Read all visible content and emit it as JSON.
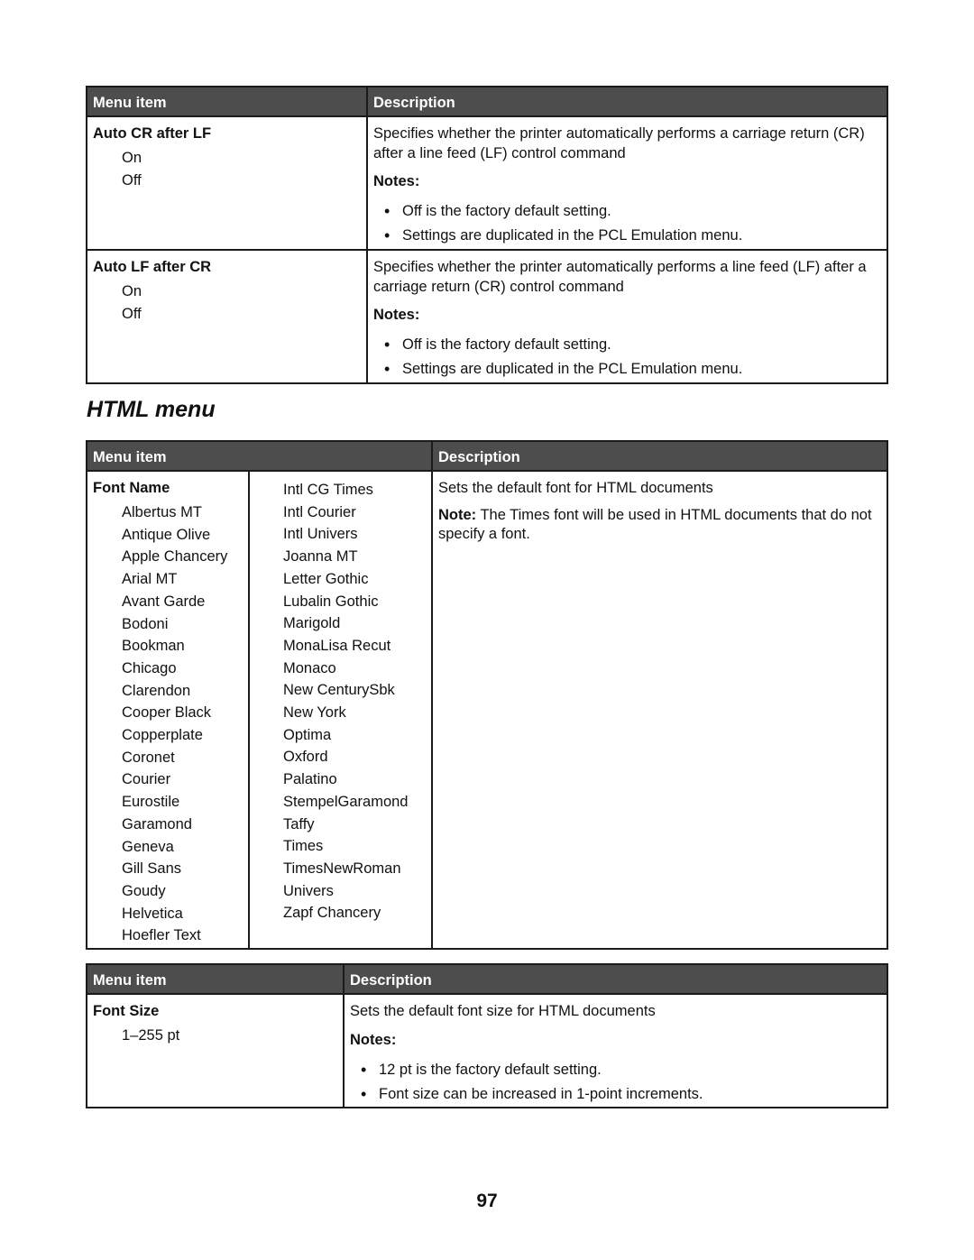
{
  "table1": {
    "header": {
      "menu_item": "Menu item",
      "description": "Description"
    },
    "rows": [
      {
        "title": "Auto CR after LF",
        "options": [
          "On",
          "Off"
        ],
        "description": "Specifies whether the printer automatically performs a carriage return (CR) after a line feed (LF) control command",
        "notes_label": "Notes:",
        "notes": [
          "Off is the factory default setting.",
          "Settings are duplicated in the PCL Emulation menu."
        ]
      },
      {
        "title": "Auto LF after CR",
        "options": [
          "On",
          "Off"
        ],
        "description": "Specifies whether the printer automatically performs a line feed (LF) after a carriage return (CR) control command",
        "notes_label": "Notes:",
        "notes": [
          "Off is the factory default setting.",
          "Settings are duplicated in the PCL Emulation menu."
        ]
      }
    ]
  },
  "section_title": "HTML menu",
  "table2": {
    "header": {
      "menu_item": "Menu item",
      "description": "Description"
    },
    "title": "Font Name",
    "fonts_col1": [
      "Albertus MT",
      "Antique Olive",
      "Apple Chancery",
      "Arial MT",
      "Avant Garde",
      "Bodoni",
      "Bookman",
      "Chicago",
      "Clarendon",
      "Cooper Black",
      "Copperplate",
      "Coronet",
      "Courier",
      "Eurostile",
      "Garamond",
      "Geneva",
      "Gill Sans",
      "Goudy",
      "Helvetica",
      "Hoefler Text"
    ],
    "fonts_col2": [
      "Intl CG Times",
      "Intl Courier",
      "Intl Univers",
      "Joanna MT",
      "Letter Gothic",
      "Lubalin Gothic",
      "Marigold",
      "MonaLisa Recut",
      "Monaco",
      "New CenturySbk",
      "New York",
      "Optima",
      "Oxford",
      "Palatino",
      "StempelGaramond",
      "Taffy",
      "Times",
      "TimesNewRoman",
      "Univers",
      "Zapf Chancery"
    ],
    "description": "Sets the default font for HTML documents",
    "note_label": "Note:",
    "note_text": " The Times font will be used in HTML documents that do not specify a font."
  },
  "table3": {
    "header": {
      "menu_item": "Menu item",
      "description": "Description"
    },
    "title": "Font Size",
    "options": [
      "1–255 pt"
    ],
    "description": "Sets the default font size for HTML documents",
    "notes_label": "Notes:",
    "notes": [
      "12 pt is the factory default setting.",
      "Font size can be increased in 1-point increments."
    ]
  },
  "page_number": "97"
}
